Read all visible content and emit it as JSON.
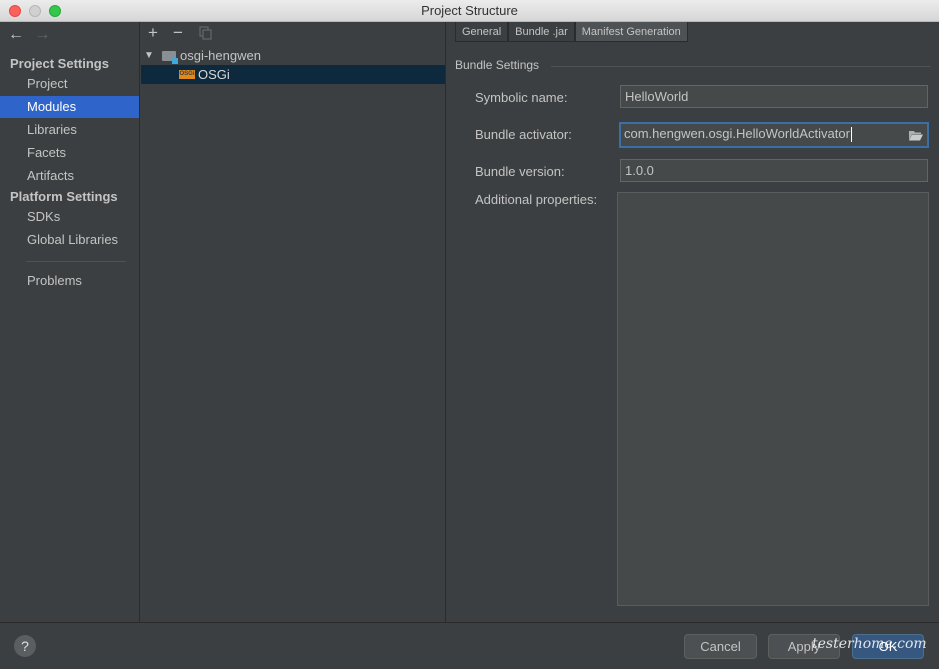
{
  "window": {
    "title": "Project Structure"
  },
  "sidebar": {
    "project_settings_heading": "Project Settings",
    "project_items": [
      {
        "label": "Project"
      },
      {
        "label": "Modules",
        "selected": true
      },
      {
        "label": "Libraries"
      },
      {
        "label": "Facets"
      },
      {
        "label": "Artifacts"
      }
    ],
    "platform_settings_heading": "Platform Settings",
    "platform_items": [
      {
        "label": "SDKs"
      },
      {
        "label": "Global Libraries"
      }
    ],
    "problems_label": "Problems"
  },
  "tree": {
    "root": {
      "label": "osgi-hengwen",
      "expanded": true
    },
    "child": {
      "label": "OSGi",
      "badge": "OSGi",
      "selected": true
    }
  },
  "tabs": [
    {
      "label": "General"
    },
    {
      "label": "Bundle .jar"
    },
    {
      "label": "Manifest Generation",
      "active": true
    }
  ],
  "bundle_settings": {
    "heading": "Bundle Settings",
    "symbolic_name_label": "Symbolic name:",
    "symbolic_name_value": "HelloWorld",
    "activator_label": "Bundle activator:",
    "activator_value": "com.hengwen.osgi.HelloWorldActivator",
    "version_label": "Bundle version:",
    "version_value": "1.0.0",
    "additional_label": "Additional properties:"
  },
  "footer": {
    "help_label": "?",
    "cancel_label": "Cancel",
    "apply_label": "Apply",
    "ok_label": "OK",
    "watermark": "testerhome.com"
  },
  "colors": {
    "selection": "#2f65ca",
    "tree_selection": "#0d293e",
    "focus_border": "#3d6fa7",
    "ok_button": "#365880"
  }
}
